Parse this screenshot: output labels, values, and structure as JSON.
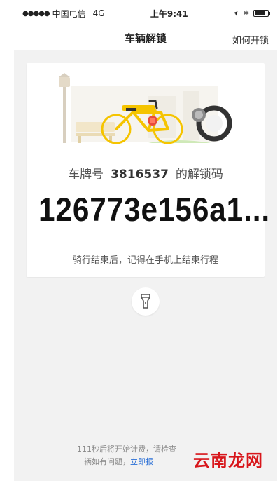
{
  "status_bar": {
    "signal_dots": "●●●●●",
    "carrier": "中国电信",
    "network": "4G",
    "time": "上午9:41",
    "location_arrow": "➤",
    "bluetooth": "✱",
    "battery_level": 0.8
  },
  "nav": {
    "title": "车辆解锁",
    "right_action": "如何开锁"
  },
  "card": {
    "plate_prefix": "车牌号",
    "plate_number": "3816537",
    "plate_suffix": "的解锁码",
    "unlock_code": "126773e156a1...",
    "reminder": "骑行结束后，记得在手机上结束行程"
  },
  "flashlight": {
    "icon": "flashlight-icon"
  },
  "footer": {
    "line1": "111秒后将开始计费，请检查",
    "line2_prefix": "辆如有问题，",
    "line2_link": "立即报"
  },
  "watermark": "云南龙网",
  "colors": {
    "bike_yellow": "#f5c400",
    "link_blue": "#2a6fd6",
    "watermark_red": "#d8161b"
  }
}
